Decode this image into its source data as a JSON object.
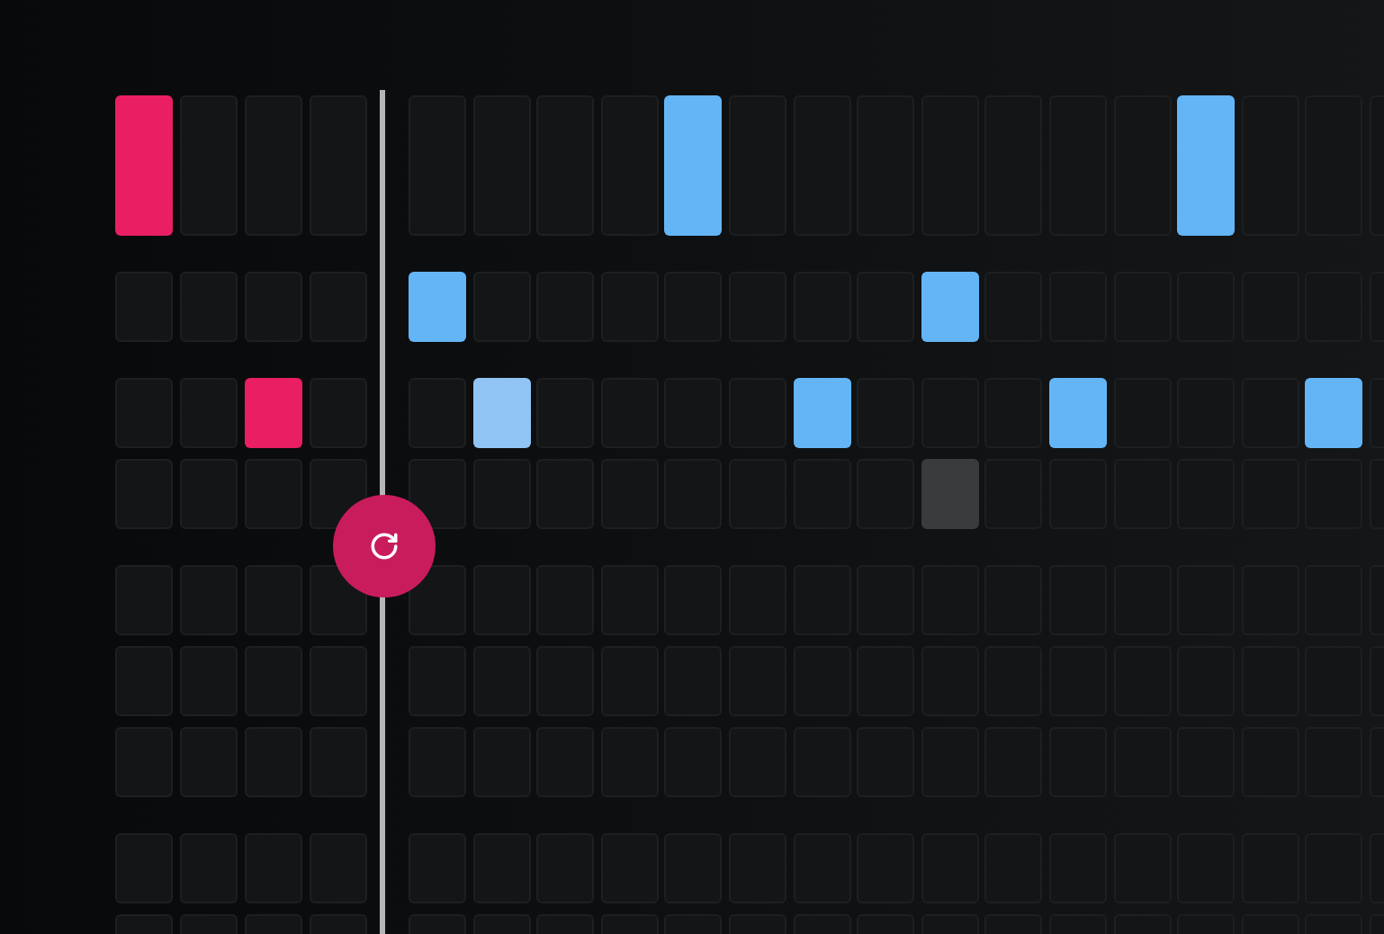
{
  "groups": [
    {
      "rows": [
        {
          "kind": "tall",
          "cells": [
            {
              "kind": "note",
              "color": "#e91e63"
            },
            {
              "kind": "pad"
            },
            {
              "kind": "pad"
            },
            {
              "kind": "pad"
            },
            {
              "kind": "pad"
            },
            {
              "kind": "pad"
            },
            {
              "kind": "pad"
            },
            {
              "kind": "pad"
            },
            {
              "kind": "note",
              "color": "#64b5f6"
            },
            {
              "kind": "pad"
            },
            {
              "kind": "pad"
            },
            {
              "kind": "pad"
            },
            {
              "kind": "pad"
            },
            {
              "kind": "pad"
            },
            {
              "kind": "pad"
            },
            {
              "kind": "pad"
            },
            {
              "kind": "note",
              "color": "#64b5f6"
            },
            {
              "kind": "pad"
            },
            {
              "kind": "pad"
            },
            {
              "kind": "pad"
            }
          ]
        }
      ]
    },
    {
      "rows": [
        {
          "kind": "short",
          "cells": [
            {
              "kind": "pad"
            },
            {
              "kind": "pad"
            },
            {
              "kind": "pad"
            },
            {
              "kind": "pad"
            },
            {
              "kind": "note",
              "color": "#64b5f6"
            },
            {
              "kind": "pad"
            },
            {
              "kind": "pad"
            },
            {
              "kind": "pad"
            },
            {
              "kind": "pad"
            },
            {
              "kind": "pad"
            },
            {
              "kind": "pad"
            },
            {
              "kind": "pad"
            },
            {
              "kind": "note",
              "color": "#64b5f6"
            },
            {
              "kind": "pad"
            },
            {
              "kind": "pad"
            },
            {
              "kind": "pad"
            },
            {
              "kind": "pad"
            },
            {
              "kind": "pad"
            },
            {
              "kind": "pad"
            },
            {
              "kind": "pad"
            }
          ]
        }
      ]
    },
    {
      "rows": [
        {
          "kind": "short",
          "cells": [
            {
              "kind": "pad"
            },
            {
              "kind": "pad"
            },
            {
              "kind": "note",
              "color": "#e91e63"
            },
            {
              "kind": "pad"
            },
            {
              "kind": "pad"
            },
            {
              "kind": "note",
              "color": "#90c4f5"
            },
            {
              "kind": "pad"
            },
            {
              "kind": "pad"
            },
            {
              "kind": "pad"
            },
            {
              "kind": "pad"
            },
            {
              "kind": "note",
              "color": "#64b5f6"
            },
            {
              "kind": "pad"
            },
            {
              "kind": "pad"
            },
            {
              "kind": "pad"
            },
            {
              "kind": "note",
              "color": "#64b5f6"
            },
            {
              "kind": "pad"
            },
            {
              "kind": "pad"
            },
            {
              "kind": "pad"
            },
            {
              "kind": "note",
              "color": "#64b5f6"
            },
            {
              "kind": "pad"
            }
          ]
        },
        {
          "kind": "short",
          "cells": [
            {
              "kind": "pad"
            },
            {
              "kind": "pad"
            },
            {
              "kind": "pad"
            },
            {
              "kind": "pad"
            },
            {
              "kind": "pad"
            },
            {
              "kind": "pad"
            },
            {
              "kind": "pad"
            },
            {
              "kind": "pad"
            },
            {
              "kind": "pad"
            },
            {
              "kind": "pad"
            },
            {
              "kind": "pad"
            },
            {
              "kind": "pad"
            },
            {
              "kind": "hover"
            },
            {
              "kind": "pad"
            },
            {
              "kind": "pad"
            },
            {
              "kind": "pad"
            },
            {
              "kind": "pad"
            },
            {
              "kind": "pad"
            },
            {
              "kind": "pad"
            },
            {
              "kind": "pad"
            }
          ]
        }
      ]
    },
    {
      "rows": [
        {
          "kind": "short",
          "cells": [
            {
              "kind": "pad"
            },
            {
              "kind": "pad"
            },
            {
              "kind": "pad"
            },
            {
              "kind": "pad"
            },
            {
              "kind": "pad"
            },
            {
              "kind": "pad"
            },
            {
              "kind": "pad"
            },
            {
              "kind": "pad"
            },
            {
              "kind": "pad"
            },
            {
              "kind": "pad"
            },
            {
              "kind": "pad"
            },
            {
              "kind": "pad"
            },
            {
              "kind": "pad"
            },
            {
              "kind": "pad"
            },
            {
              "kind": "pad"
            },
            {
              "kind": "pad"
            },
            {
              "kind": "pad"
            },
            {
              "kind": "pad"
            },
            {
              "kind": "pad"
            },
            {
              "kind": "pad"
            }
          ]
        },
        {
          "kind": "short",
          "cells": [
            {
              "kind": "pad"
            },
            {
              "kind": "pad"
            },
            {
              "kind": "pad"
            },
            {
              "kind": "pad"
            },
            {
              "kind": "pad"
            },
            {
              "kind": "pad"
            },
            {
              "kind": "pad"
            },
            {
              "kind": "pad"
            },
            {
              "kind": "pad"
            },
            {
              "kind": "pad"
            },
            {
              "kind": "pad"
            },
            {
              "kind": "pad"
            },
            {
              "kind": "pad"
            },
            {
              "kind": "pad"
            },
            {
              "kind": "pad"
            },
            {
              "kind": "pad"
            },
            {
              "kind": "pad"
            },
            {
              "kind": "pad"
            },
            {
              "kind": "pad"
            },
            {
              "kind": "pad"
            }
          ]
        },
        {
          "kind": "short",
          "cells": [
            {
              "kind": "pad"
            },
            {
              "kind": "pad"
            },
            {
              "kind": "pad"
            },
            {
              "kind": "pad"
            },
            {
              "kind": "pad"
            },
            {
              "kind": "pad"
            },
            {
              "kind": "pad"
            },
            {
              "kind": "pad"
            },
            {
              "kind": "pad"
            },
            {
              "kind": "pad"
            },
            {
              "kind": "pad"
            },
            {
              "kind": "pad"
            },
            {
              "kind": "pad"
            },
            {
              "kind": "pad"
            },
            {
              "kind": "pad"
            },
            {
              "kind": "pad"
            },
            {
              "kind": "pad"
            },
            {
              "kind": "pad"
            },
            {
              "kind": "pad"
            },
            {
              "kind": "pad"
            }
          ]
        }
      ]
    },
    {
      "rows": [
        {
          "kind": "short",
          "cells": [
            {
              "kind": "pad"
            },
            {
              "kind": "pad"
            },
            {
              "kind": "pad"
            },
            {
              "kind": "pad"
            },
            {
              "kind": "pad"
            },
            {
              "kind": "pad"
            },
            {
              "kind": "pad"
            },
            {
              "kind": "pad"
            },
            {
              "kind": "pad"
            },
            {
              "kind": "pad"
            },
            {
              "kind": "pad"
            },
            {
              "kind": "pad"
            },
            {
              "kind": "pad"
            },
            {
              "kind": "pad"
            },
            {
              "kind": "pad"
            },
            {
              "kind": "pad"
            },
            {
              "kind": "pad"
            },
            {
              "kind": "pad"
            },
            {
              "kind": "pad"
            },
            {
              "kind": "pad"
            }
          ]
        },
        {
          "kind": "short",
          "cells": [
            {
              "kind": "pad"
            },
            {
              "kind": "pad"
            },
            {
              "kind": "pad"
            },
            {
              "kind": "pad"
            },
            {
              "kind": "pad"
            },
            {
              "kind": "pad"
            },
            {
              "kind": "pad"
            },
            {
              "kind": "pad"
            },
            {
              "kind": "pad"
            },
            {
              "kind": "pad"
            },
            {
              "kind": "pad"
            },
            {
              "kind": "pad"
            },
            {
              "kind": "pad"
            },
            {
              "kind": "pad"
            },
            {
              "kind": "pad"
            },
            {
              "kind": "pad"
            },
            {
              "kind": "pad"
            },
            {
              "kind": "pad"
            },
            {
              "kind": "pad"
            },
            {
              "kind": "pad"
            }
          ]
        }
      ]
    }
  ]
}
